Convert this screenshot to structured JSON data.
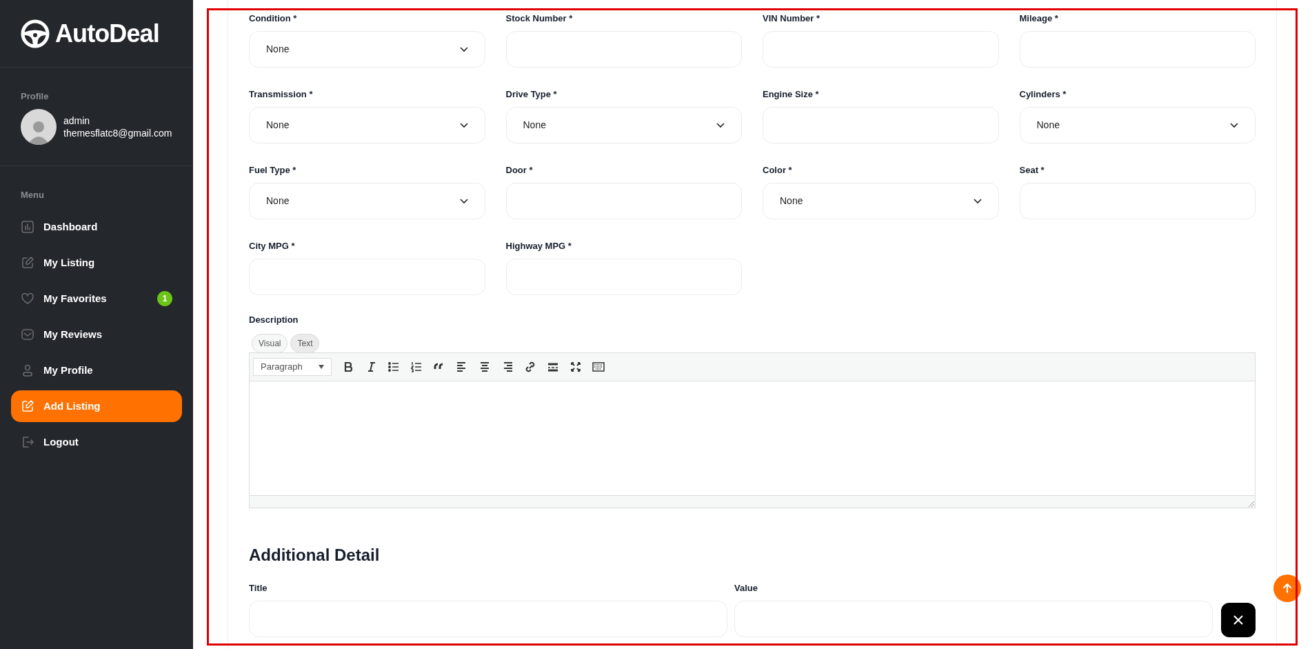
{
  "sidebar": {
    "logo": "AutoDeal",
    "profile_label": "Profile",
    "user": {
      "name": "admin",
      "email": "themesflatc8@gmail.com"
    },
    "menu_label": "Menu",
    "items": [
      {
        "label": "Dashboard",
        "selected": false
      },
      {
        "label": "My Listing",
        "selected": false
      },
      {
        "label": "My Favorites",
        "selected": false,
        "badge": "1"
      },
      {
        "label": "My Reviews",
        "selected": false
      },
      {
        "label": "My Profile",
        "selected": false
      },
      {
        "label": "Add Listing",
        "selected": true
      },
      {
        "label": "Logout",
        "selected": false
      }
    ]
  },
  "form": {
    "fields": [
      {
        "kind": "select",
        "label": "Condition *",
        "value": "None"
      },
      {
        "kind": "text",
        "label": "Stock Number *"
      },
      {
        "kind": "text",
        "label": "VIN Number *"
      },
      {
        "kind": "text",
        "label": "Mileage *"
      },
      {
        "kind": "select",
        "label": "Transmission *",
        "value": "None"
      },
      {
        "kind": "select",
        "label": "Drive Type *",
        "value": "None"
      },
      {
        "kind": "text",
        "label": "Engine Size *"
      },
      {
        "kind": "select",
        "label": "Cylinders *",
        "value": "None"
      },
      {
        "kind": "select",
        "label": "Fuel Type *",
        "value": "None"
      },
      {
        "kind": "text",
        "label": "Door *"
      },
      {
        "kind": "select",
        "label": "Color *",
        "value": "None"
      },
      {
        "kind": "text",
        "label": "Seat *"
      },
      {
        "kind": "text",
        "label": "City MPG *"
      },
      {
        "kind": "text",
        "label": "Highway MPG *"
      }
    ],
    "description": {
      "label": "Description",
      "tabs": [
        {
          "label": "Visual",
          "selected": true
        },
        {
          "label": "Text",
          "selected": false
        }
      ],
      "format": "Paragraph"
    },
    "additional_detail": {
      "heading": "Additional Detail",
      "columns": [
        "Title",
        "Value"
      ]
    }
  }
}
